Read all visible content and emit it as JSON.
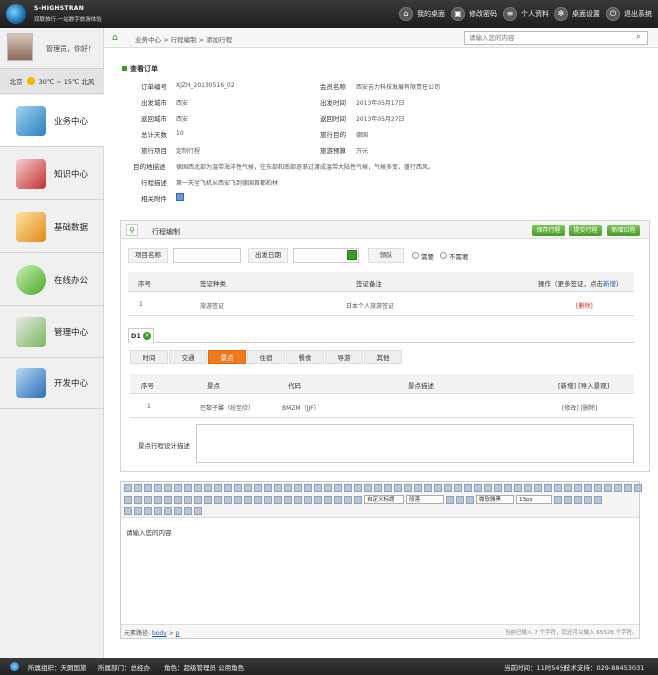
{
  "header": {
    "logo_line1": "S-HIGHSTRAN",
    "logo_line2": "润联旅行·一站数字旅游体验",
    "nav": [
      {
        "label": "我的桌面",
        "icon": "home-icon"
      },
      {
        "label": "修改密码",
        "icon": "lock-icon"
      },
      {
        "label": "个人资料",
        "icon": "profile-icon"
      },
      {
        "label": "桌面设置",
        "icon": "gear-icon"
      },
      {
        "label": "退出系统",
        "icon": "power-icon"
      }
    ]
  },
  "sidebar": {
    "greeting": "管理员，你好！",
    "weather": {
      "city": "北京",
      "temp": "30℃ ~ 15℃ 北风"
    },
    "items": [
      {
        "label": "业务中心",
        "icon": "business-center-icon",
        "active": true
      },
      {
        "label": "知识中心",
        "icon": "knowledge-center-icon",
        "active": false
      },
      {
        "label": "基础数据",
        "icon": "base-data-icon",
        "active": false
      },
      {
        "label": "在线办公",
        "icon": "online-office-icon",
        "active": false
      },
      {
        "label": "管理中心",
        "icon": "management-center-icon",
        "active": false
      },
      {
        "label": "开发中心",
        "icon": "dev-center-icon",
        "active": false
      }
    ]
  },
  "breadcrumb": {
    "text": "业务中心 > 行程编制 > 添加行程"
  },
  "search": {
    "placeholder": "请输入您的内容"
  },
  "order": {
    "title": "查看订单",
    "left": [
      {
        "label": "订单编号",
        "value": "XJZH_20130516_02"
      },
      {
        "label": "出发城市",
        "value": "西安"
      },
      {
        "label": "返回城市",
        "value": "西安"
      },
      {
        "label": "总计天数",
        "value": "10"
      },
      {
        "label": "旅行项目",
        "value": "定制行程"
      }
    ],
    "right": [
      {
        "label": "会员名称",
        "value": "西安吉力科技发展有限责任公司"
      },
      {
        "label": "出发时间",
        "value": "2013年05月17日"
      },
      {
        "label": "返回时间",
        "value": "2013年05月27日"
      },
      {
        "label": "旅行目的",
        "value": "德国"
      },
      {
        "label": "旅游预算",
        "value": "万元"
      }
    ],
    "dest_desc_label": "目的地描述",
    "dest_desc": "德国西北部为温带海洋性气候，往东部和南部逐渐过渡成温带大陆性气候，气候多变，盛行西风。",
    "trip_desc_label": "行程描述",
    "trip_desc": "第一天坐飞机从西安飞到德国首都柏林",
    "attach_label": "相关附件"
  },
  "itinerary": {
    "title": "行程编制",
    "buttons": [
      "保存行程",
      "提交行程",
      "新增日程"
    ],
    "project_label": "项目名称",
    "date_label": "出发日期",
    "escort_label": "领队",
    "radio_need": "需要",
    "radio_noneed": "不需要",
    "visa_headers": [
      "序号",
      "签证种类",
      "签证备注",
      "操作（更多签证，点击"
    ],
    "visa_add": "新增",
    "visa_header_tail": "）",
    "visa_rows": [
      {
        "no": "1",
        "type": "旅游签证",
        "note": "日本个人旅游签证",
        "op": "删除"
      }
    ],
    "day_tab": "D1",
    "sub_tabs": [
      "时间",
      "交通",
      "景点",
      "住宿",
      "餐食",
      "导游",
      "其他"
    ],
    "active_sub_tab": "景点",
    "spot_headers": [
      "序号",
      "景点",
      "代码",
      "景点描述",
      "[新增] [导入景观]"
    ],
    "spot_rows": [
      {
        "no": "1",
        "name": "巴黎子馨（纷至欣）",
        "code": "BMZM（JJF）",
        "desc": "",
        "op": "[修改] [删除]"
      }
    ],
    "spot_design_label": "景点行程设计描述"
  },
  "editor": {
    "font_select": "自定义标题",
    "para_select": "段落",
    "family_select": "微软雅黑",
    "size_select": "13px",
    "content": "请输入您的内容",
    "path_label": "元素路径:",
    "path_body": "body",
    "path_sep": ">",
    "path_p": "p",
    "count_text": "当前已输入 7 个字符，您还可以输入 65528 个字符。"
  },
  "footer": {
    "org": "所属组织：天朗国旅",
    "dept": "所属部门：总经办",
    "role": "角色：超级管理员 公用角色",
    "time": "当前时间：11时54分",
    "support": "技术支持：029-88453031"
  }
}
